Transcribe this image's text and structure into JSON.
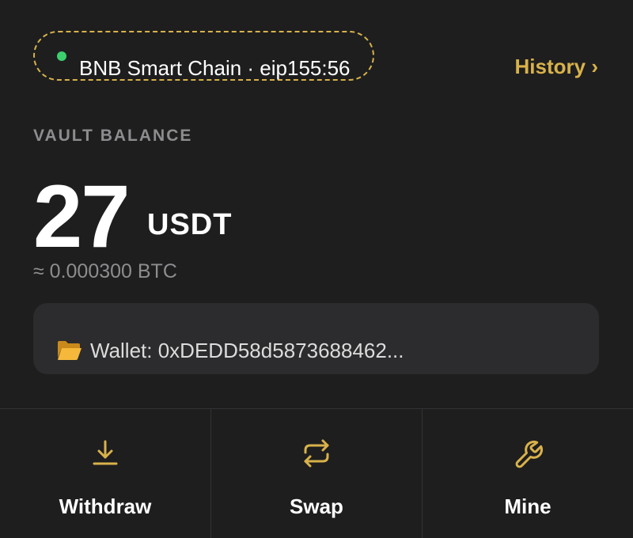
{
  "network": {
    "label": "BNB Smart Chain · eip155:56",
    "status_color": "#3ccf6e"
  },
  "header": {
    "history_label": "History ›"
  },
  "vault": {
    "section_label": "VAULT BALANCE",
    "amount": "27",
    "unit": "USDT",
    "conversion": "≈ 0.000300 BTC"
  },
  "wallet": {
    "icon": "folder-open-icon",
    "text": "Wallet: 0xDEDD58d5873688462..."
  },
  "actions": [
    {
      "label": "Withdraw",
      "icon": "download-icon"
    },
    {
      "label": "Swap",
      "icon": "swap-arrows-icon"
    },
    {
      "label": "Mine",
      "icon": "wrench-icon"
    }
  ],
  "colors": {
    "accent": "#d8b24a",
    "background": "#1e1e1f",
    "card": "#2c2c2e",
    "muted_text": "#8d8d90"
  }
}
